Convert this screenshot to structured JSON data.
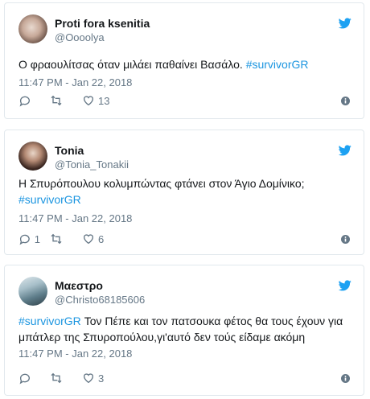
{
  "colors": {
    "text": "#14171a",
    "muted": "#657786",
    "link": "#1b95e0",
    "border": "#e1e8ed",
    "twitter_blue": "#1da1f2"
  },
  "tweets": [
    {
      "display_name": "Proti fora ksenitia",
      "handle": "@Oooolya",
      "text": "Ο φραουλίτσας όταν μιλάει παθαίνει Βασάλο.",
      "hashtag": "#survivorGR",
      "text_after": "",
      "timestamp": "11:47 PM - Jan 22, 2018",
      "reply_count": "",
      "retweet_count": "",
      "like_count": "13",
      "icons": {
        "avatar": "user-avatar-icon",
        "brand": "twitter-bird-icon",
        "reply": "reply-icon",
        "retweet": "retweet-icon",
        "like": "heart-icon",
        "info": "info-icon"
      }
    },
    {
      "display_name": "Tonia",
      "handle": "@Tonia_Tonakii",
      "text": "Η Σπυρόπουλου κολυμπώντας φτάνει στον Άγιο Δομίνικο;",
      "hashtag": "#survivorGR",
      "text_after": "",
      "timestamp": "11:47 PM - Jan 22, 2018",
      "reply_count": "1",
      "retweet_count": "",
      "like_count": "6",
      "icons": {
        "avatar": "user-avatar-icon",
        "brand": "twitter-bird-icon",
        "reply": "reply-icon",
        "retweet": "retweet-icon",
        "like": "heart-icon",
        "info": "info-icon"
      }
    },
    {
      "display_name": "Μαεστρο",
      "handle": "@Christo68185606",
      "text": "",
      "hashtag": "#survivorGR",
      "text_after": "Τον Πέπε και τον πατσουκα φέτος θα τους έχουν για μπάτλερ της Σπυροπούλου,γι'αυτό δεν τούς είδαμε ακόμη",
      "timestamp": "11:47 PM - Jan 22, 2018",
      "reply_count": "",
      "retweet_count": "",
      "like_count": "3",
      "icons": {
        "avatar": "user-avatar-icon",
        "brand": "twitter-bird-icon",
        "reply": "reply-icon",
        "retweet": "retweet-icon",
        "like": "heart-icon",
        "info": "info-icon"
      }
    }
  ]
}
